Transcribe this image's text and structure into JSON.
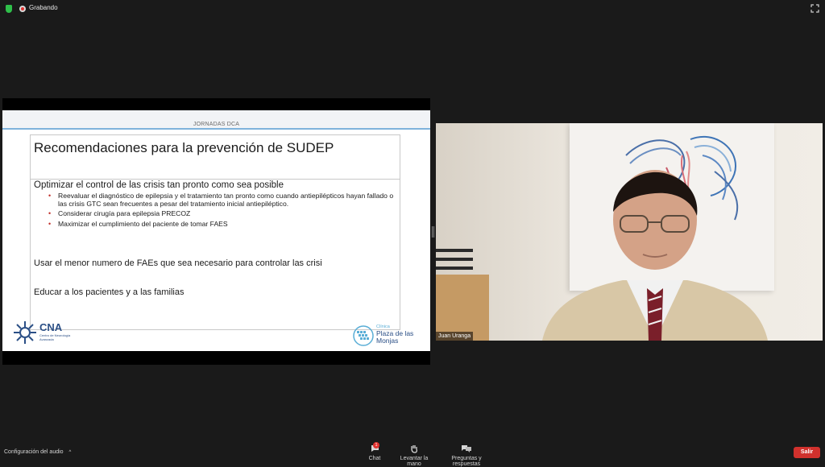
{
  "topbar": {
    "recording_label": "Grabando",
    "icons": [
      "shield-icon",
      "recording-icon",
      "fullscreen-icon"
    ]
  },
  "slide": {
    "header": "JORNADAS DCA",
    "title": "Recomendaciones para la prevención de SUDEP",
    "lead": "Optimizar el control de las crisis tan pronto como sea posible",
    "bullets": [
      "Reevaluar el diagnóstico de epilepsia y el tratamiento tan pronto como cuando antiepilépticos hayan fallado o las crisis GTC sean frecuentes a pesar del tratamiento inicial antiepiléptico.",
      "Considerar cirugía para epilepsia PRECOZ",
      "Maximizar el cumplimiento del paciente de tomar FAES"
    ],
    "para1": "Usar el menor numero de FAEs que sea necesario para controlar las crisi",
    "para2": "Educar a los pacientes y a las familias",
    "logo_left": {
      "name": "CNA",
      "subtitle": "Centro de Neurología Avanzada"
    },
    "logo_right": {
      "subtitle": "Clínica",
      "name": "Plaza de las Monjas"
    }
  },
  "video": {
    "participant_name": "Juan Uranga"
  },
  "bottombar": {
    "audio_settings": "Configuración del audio",
    "chat_label": "Chat",
    "chat_badge": "1",
    "raise_hand_label": "Levantar la mano",
    "qa_label": "Preguntas y respuestas",
    "leave_label": "Salir"
  },
  "colors": {
    "background": "#1a1a1a",
    "leave": "#d1312d",
    "badge": "#e0322f",
    "slide_accent": "#7fb3dc",
    "bullet": "#c0302b"
  }
}
